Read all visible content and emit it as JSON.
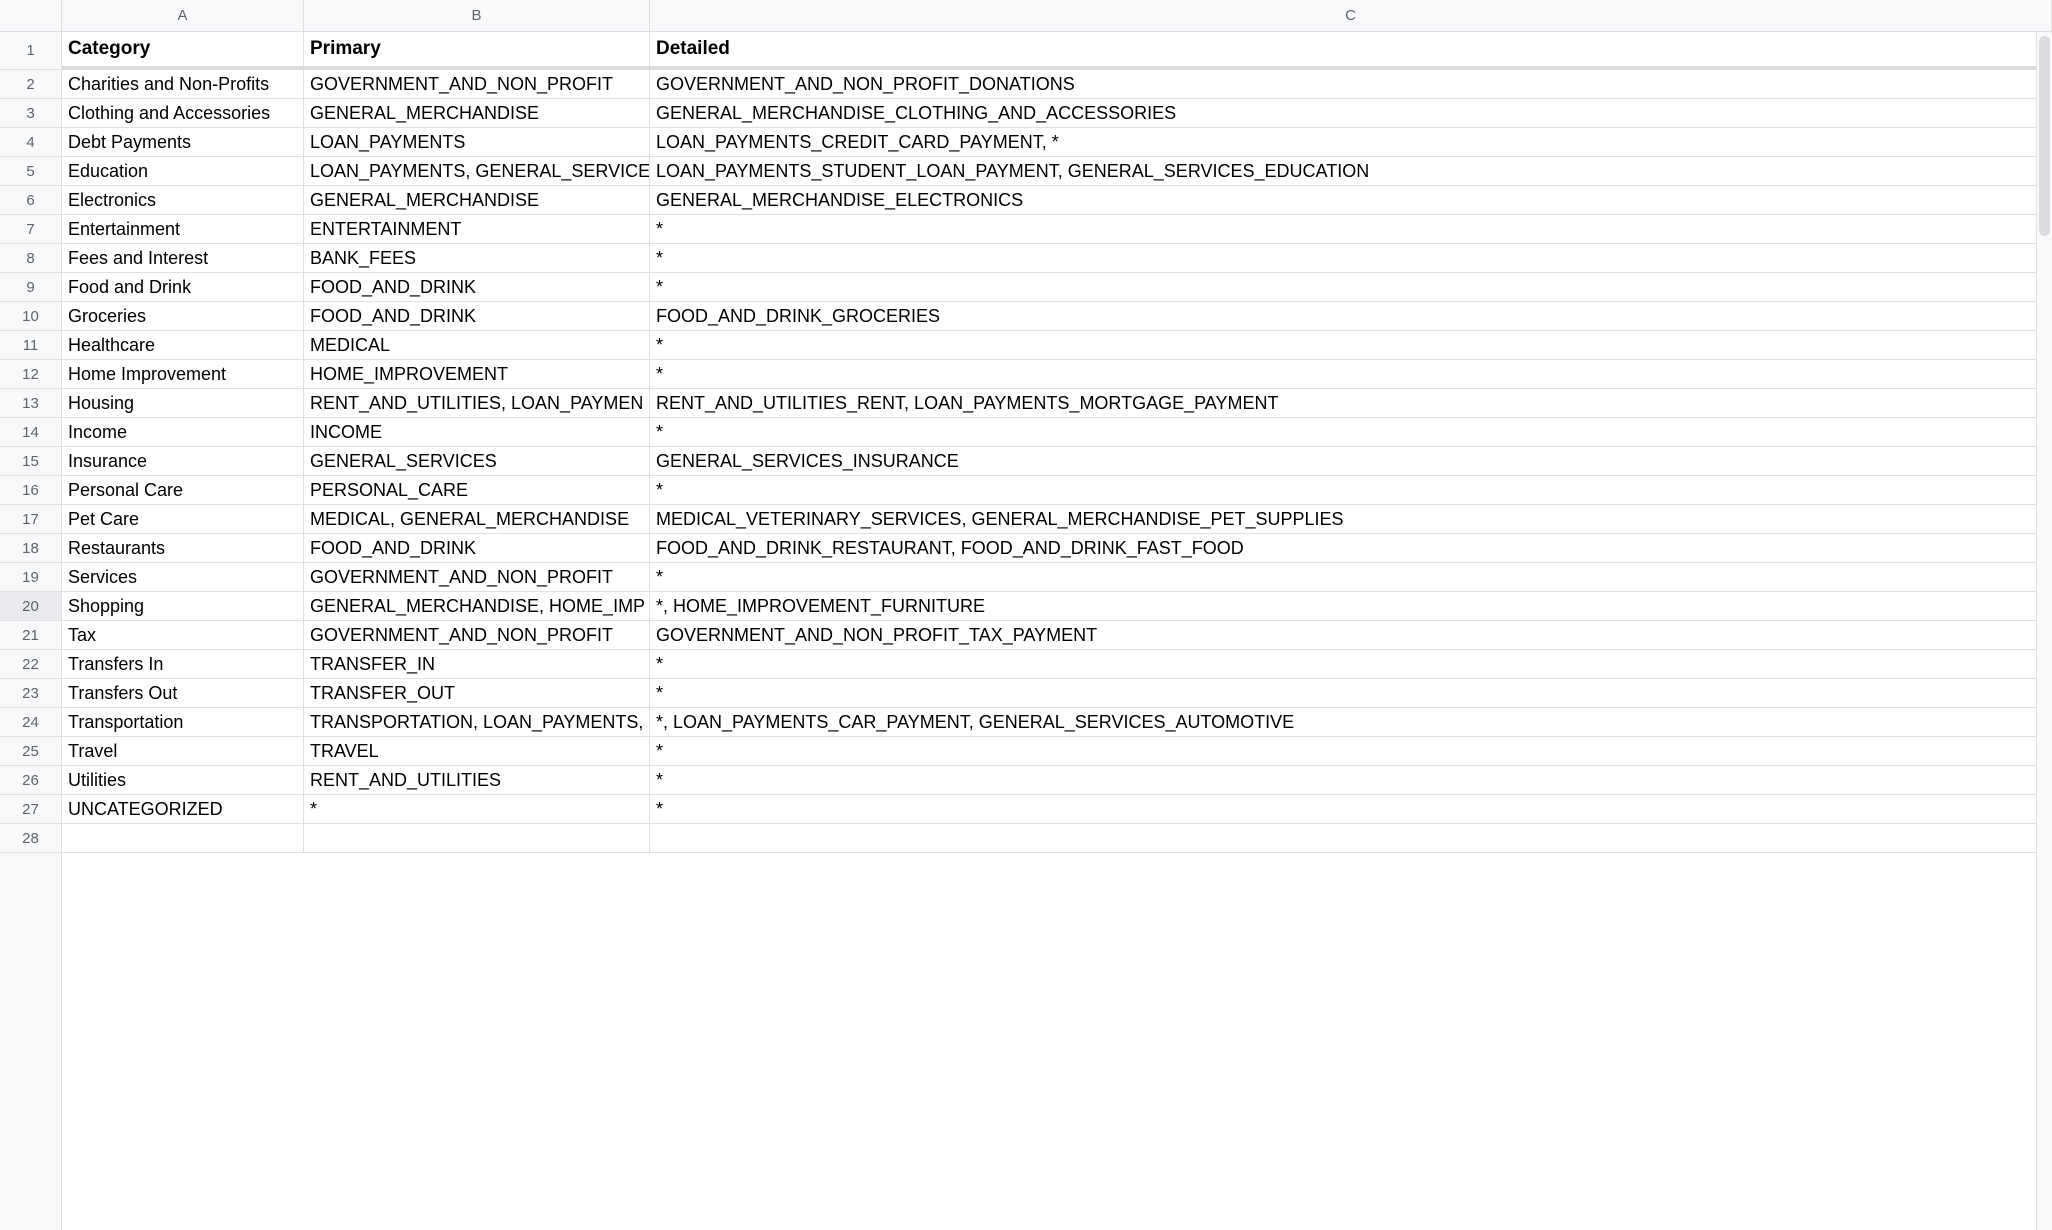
{
  "columns": [
    "A",
    "B",
    "C"
  ],
  "header_row": {
    "number": "1",
    "cells": [
      "Category",
      "Primary",
      "Detailed"
    ]
  },
  "rows": [
    {
      "number": "2",
      "cells": [
        "Charities and Non-Profits",
        "GOVERNMENT_AND_NON_PROFIT",
        "GOVERNMENT_AND_NON_PROFIT_DONATIONS"
      ]
    },
    {
      "number": "3",
      "cells": [
        "Clothing and Accessories",
        "GENERAL_MERCHANDISE",
        "GENERAL_MERCHANDISE_CLOTHING_AND_ACCESSORIES"
      ]
    },
    {
      "number": "4",
      "cells": [
        "Debt Payments",
        "LOAN_PAYMENTS",
        "LOAN_PAYMENTS_CREDIT_CARD_PAYMENT, *"
      ]
    },
    {
      "number": "5",
      "cells": [
        "Education",
        "LOAN_PAYMENTS, GENERAL_SERVICE",
        "LOAN_PAYMENTS_STUDENT_LOAN_PAYMENT, GENERAL_SERVICES_EDUCATION"
      ]
    },
    {
      "number": "6",
      "cells": [
        "Electronics",
        "GENERAL_MERCHANDISE",
        "GENERAL_MERCHANDISE_ELECTRONICS"
      ]
    },
    {
      "number": "7",
      "cells": [
        "Entertainment",
        "ENTERTAINMENT",
        "*"
      ]
    },
    {
      "number": "8",
      "cells": [
        "Fees and Interest",
        "BANK_FEES",
        "*"
      ]
    },
    {
      "number": "9",
      "cells": [
        "Food and Drink",
        "FOOD_AND_DRINK",
        "*"
      ]
    },
    {
      "number": "10",
      "cells": [
        "Groceries",
        "FOOD_AND_DRINK",
        "FOOD_AND_DRINK_GROCERIES"
      ]
    },
    {
      "number": "11",
      "cells": [
        "Healthcare",
        "MEDICAL",
        "*"
      ]
    },
    {
      "number": "12",
      "cells": [
        "Home Improvement",
        "HOME_IMPROVEMENT",
        "*"
      ]
    },
    {
      "number": "13",
      "cells": [
        "Housing",
        "RENT_AND_UTILITIES, LOAN_PAYMEN",
        "RENT_AND_UTILITIES_RENT, LOAN_PAYMENTS_MORTGAGE_PAYMENT"
      ]
    },
    {
      "number": "14",
      "cells": [
        "Income",
        "INCOME",
        "*"
      ]
    },
    {
      "number": "15",
      "cells": [
        "Insurance",
        "GENERAL_SERVICES",
        "GENERAL_SERVICES_INSURANCE"
      ]
    },
    {
      "number": "16",
      "cells": [
        "Personal Care",
        "PERSONAL_CARE",
        "*"
      ]
    },
    {
      "number": "17",
      "cells": [
        "Pet Care",
        "MEDICAL, GENERAL_MERCHANDISE",
        "MEDICAL_VETERINARY_SERVICES, GENERAL_MERCHANDISE_PET_SUPPLIES"
      ]
    },
    {
      "number": "18",
      "cells": [
        "Restaurants",
        "FOOD_AND_DRINK",
        "FOOD_AND_DRINK_RESTAURANT, FOOD_AND_DRINK_FAST_FOOD"
      ]
    },
    {
      "number": "19",
      "cells": [
        "Services",
        "GOVERNMENT_AND_NON_PROFIT",
        "*"
      ]
    },
    {
      "number": "20",
      "highlighted": true,
      "cells": [
        "Shopping",
        "GENERAL_MERCHANDISE, HOME_IMP",
        "*, HOME_IMPROVEMENT_FURNITURE"
      ]
    },
    {
      "number": "21",
      "cells": [
        "Tax",
        "GOVERNMENT_AND_NON_PROFIT",
        "GOVERNMENT_AND_NON_PROFIT_TAX_PAYMENT"
      ]
    },
    {
      "number": "22",
      "cells": [
        "Transfers In",
        "TRANSFER_IN",
        "*"
      ]
    },
    {
      "number": "23",
      "cells": [
        "Transfers Out",
        "TRANSFER_OUT",
        "*"
      ]
    },
    {
      "number": "24",
      "cells": [
        "Transportation",
        "TRANSPORTATION, LOAN_PAYMENTS,",
        "*, LOAN_PAYMENTS_CAR_PAYMENT, GENERAL_SERVICES_AUTOMOTIVE"
      ]
    },
    {
      "number": "25",
      "cells": [
        "Travel",
        "TRAVEL",
        "*"
      ]
    },
    {
      "number": "26",
      "cells": [
        "Utilities",
        "RENT_AND_UTILITIES",
        "*"
      ]
    },
    {
      "number": "27",
      "cells": [
        "UNCATEGORIZED",
        "*",
        "*"
      ]
    },
    {
      "number": "28",
      "cells": [
        "",
        "",
        ""
      ]
    }
  ]
}
